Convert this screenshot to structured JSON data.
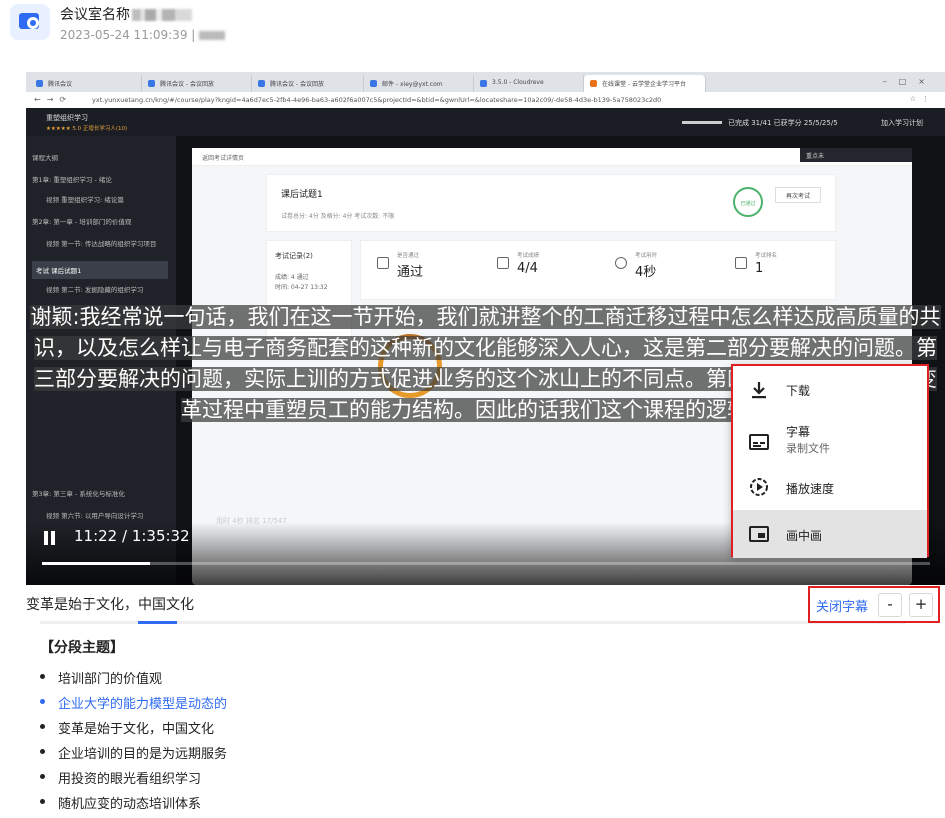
{
  "header": {
    "meeting_name": "会议室名称",
    "datetime": "2023-05-24 11:09:39 |"
  },
  "browser": {
    "tabs": [
      "腾讯会议",
      "腾讯会议 - 会议回放",
      "腾讯会议 - 会议回放",
      "邮件 - xiey@yxt.com",
      "3.5.0 - Cloudreve",
      "在线课堂 - 云学堂企业学习平台"
    ],
    "url": "yxt.yunxuetang.cn/kng/#/course/play?kngid=4a6d7ec5-2fb4-4e96-ba63-a602f6a007c5&projectId=&btid=&gwnlUrl=&locateshare=10a2c09/-de58-4d3e-b139-5a758023c2d0"
  },
  "course": {
    "title": "重塑组织学习",
    "rating": "★★★★★ 5.0   正增长学习人(10)",
    "stats": "已完成 31/41    已获学分 25/5/25/5",
    "join": "加入学习计划",
    "sidebar": [
      "课程大纲",
      "第1章: 重塑组织学习 - 绪论",
      "视频  重塑组织学习: 绪论篇",
      "第2章: 第一章 - 培训部门的价值观",
      "视频  第一节: 传达战略的组织学习项目",
      "考试  课后试题1",
      "视频  第二节: 发掘隐藏的组织学习",
      "第3章: 第三章 - 系统化与标准化",
      "视频  第六节: 以用户导向设计学习"
    ],
    "back": "返回考试详情页",
    "panel_dark": "重点未",
    "exam_title": "课后试题1",
    "exam_meta": "试卷总分: 4分    及格分: 4分    考试次数: 不限",
    "exam_stamp": "已通过",
    "retry": "再次考试",
    "history_title": "考试记录(2)",
    "history_rows": [
      "成绩: 4 通过",
      "时间: 04-27 13:32"
    ],
    "stats_cards": [
      {
        "label": "是否通过",
        "value": "通过"
      },
      {
        "label": "考试成绩",
        "value": "4/4"
      },
      {
        "label": "考试用时",
        "value": "4秒"
      },
      {
        "label": "考试排名",
        "value": "1"
      }
    ],
    "bottom": "用时 4秒    排名 17/547"
  },
  "subtitle": "谢颖:我经常说一句话，我们在这一节开始，我们就讲整个的工商迁移过程中怎么样达成高质量的共识，以及怎么样让与电子商务配套的这种新的文化能够深入人心，这是第二部分要解决的问题。第三部分要解决的问题，实际上训的方式促进业务的这个冰山上的不同点。第四部分要解决的问题变革过程中重塑员工的能力结构。因此的话我们这个课程的逻辑的。",
  "player": {
    "time": "11:22 / 1:35:32",
    "progress": 0.122
  },
  "menu": {
    "items": [
      {
        "label": "下载",
        "icon": "download-icon"
      },
      {
        "label": "字幕",
        "sub": "录制文件",
        "icon": "subtitles-icon"
      },
      {
        "label": "播放速度",
        "icon": "playback-speed-icon"
      },
      {
        "label": "画中画",
        "icon": "picture-in-picture-icon",
        "selected": true
      }
    ]
  },
  "caption_line": "变革是始于文化，中国文化",
  "caption_controls": {
    "close": "关闭字幕",
    "minus": "-",
    "plus": "+"
  },
  "section": {
    "title": "【分段主题】",
    "items": [
      "培训部门的价值观",
      "企业大学的能力模型是动态的",
      "变革是始于文化，中国文化",
      "企业培训的目的是为远期服务",
      "用投资的眼光看组织学习",
      "随机应变的动态培训体系"
    ],
    "active_index": 1
  },
  "colors": {
    "accent": "#2f6bf2",
    "highlight_border": "#e02020"
  }
}
